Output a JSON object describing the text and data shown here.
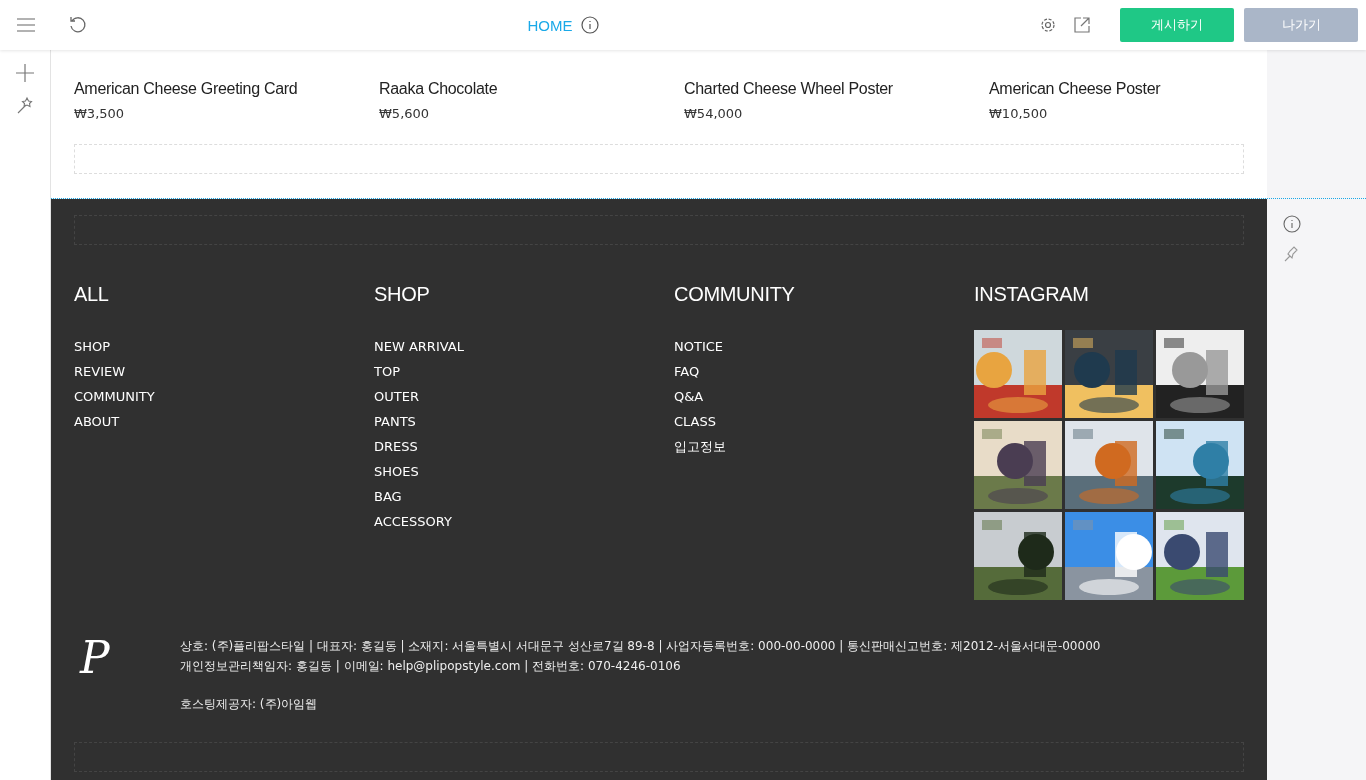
{
  "toolbar": {
    "title": "HOME",
    "publish": "게시하기",
    "exit": "나가기"
  },
  "products": [
    {
      "name": "American Cheese Greeting Card",
      "price": "₩3,500"
    },
    {
      "name": "Raaka Chocolate",
      "price": "₩5,600"
    },
    {
      "name": "Charted Cheese Wheel Poster",
      "price": "₩54,000"
    },
    {
      "name": "American Cheese Poster",
      "price": "₩10,500"
    }
  ],
  "footer": {
    "columns": [
      {
        "heading": "ALL",
        "links": [
          "SHOP",
          "REVIEW",
          "COMMUNITY",
          "ABOUT"
        ]
      },
      {
        "heading": "SHOP",
        "links": [
          "NEW ARRIVAL",
          "TOP",
          "OUTER",
          "PANTS",
          "DRESS",
          "SHOES",
          "BAG",
          "ACCESSORY"
        ]
      },
      {
        "heading": "COMMUNITY",
        "links": [
          "NOTICE",
          "FAQ",
          "Q&A",
          "CLASS",
          "입고정보"
        ]
      }
    ],
    "instagram": {
      "heading": "INSTAGRAM"
    },
    "logo": "P",
    "info_lines": [
      "상호: (주)플리팝스타일 | 대표자: 홍길동 | 소재지: 서울특별시 서대문구 성산로7길 89-8 | 사업자등록번호: 000-00-0000 | 통신판매신고번호: 제2012-서울서대문-00000",
      "개인정보관리책임자: 홍길동 | 이메일: help@plipopstyle.com | 전화번호: 070-4246-0106"
    ],
    "hosting": "호스팅제공자: (주)아임웹"
  }
}
